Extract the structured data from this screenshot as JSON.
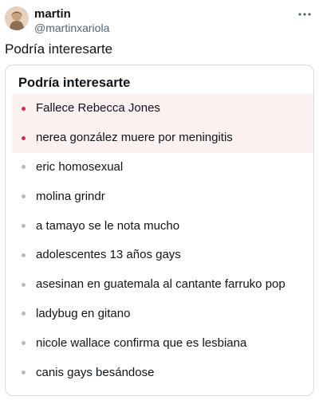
{
  "user": {
    "name": "martin",
    "handle": "@martinxariola"
  },
  "tweet": {
    "text": "Podría interesarte"
  },
  "card": {
    "title": "Podría interesarte",
    "items": [
      {
        "label": "Fallece Rebecca Jones",
        "highlighted": true
      },
      {
        "label": "nerea gonzález muere por meningitis",
        "highlighted": true
      },
      {
        "label": "eric homosexual",
        "highlighted": false
      },
      {
        "label": "molina grindr",
        "highlighted": false
      },
      {
        "label": "a tamayo se le nota mucho",
        "highlighted": false
      },
      {
        "label": "adolescentes 13 años gays",
        "highlighted": false
      },
      {
        "label": "asesinan en guatemala al cantante farruko pop",
        "highlighted": false
      },
      {
        "label": "ladybug en gitano",
        "highlighted": false
      },
      {
        "label": "nicole wallace confirma que es lesbiana",
        "highlighted": false
      },
      {
        "label": "canis gays besándose",
        "highlighted": false
      }
    ]
  },
  "colors": {
    "highlight_dot": "#e0245e",
    "normal_dot": "#b9b9b9",
    "highlight_bg": "#fdf1f2"
  },
  "icons": {
    "more": "more-options-icon",
    "avatar": "avatar"
  }
}
